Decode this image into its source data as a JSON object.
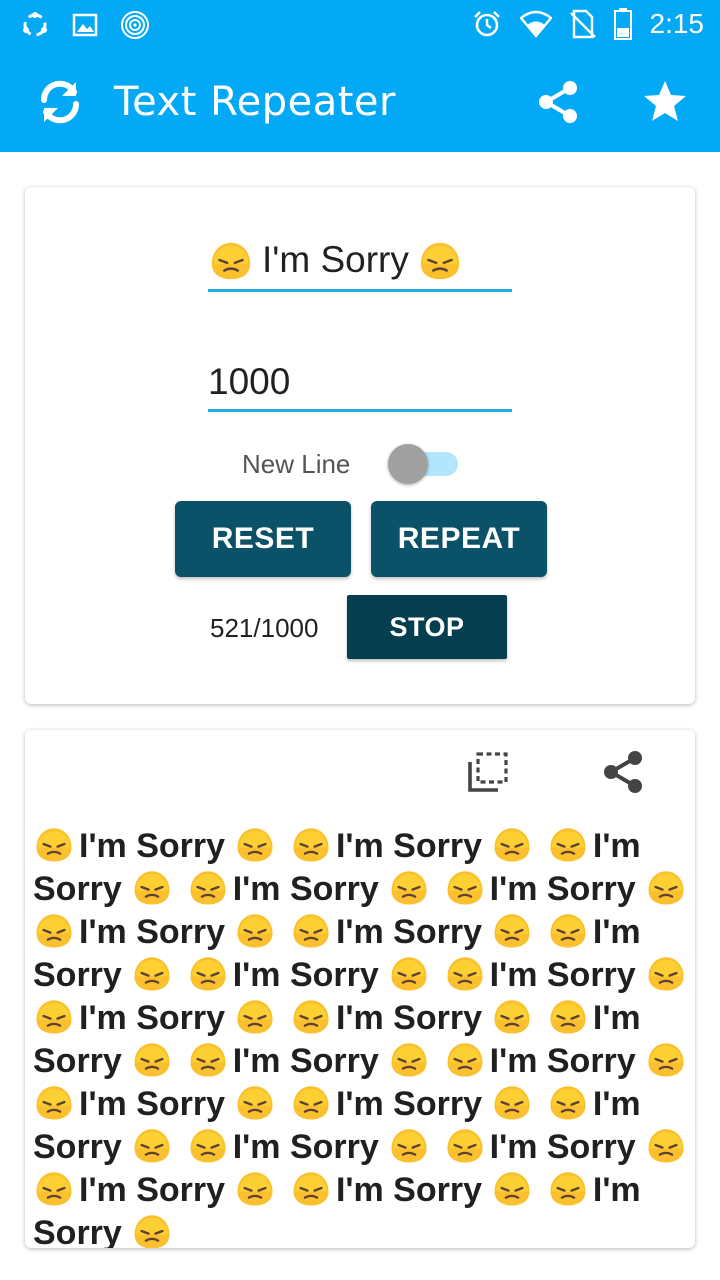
{
  "status_bar": {
    "time": "2:15",
    "left_icons": [
      "sync-circle-icon",
      "image-icon",
      "target-icon"
    ],
    "right_icons": [
      "alarm-icon",
      "wifi-icon",
      "no-sim-icon",
      "battery-icon"
    ]
  },
  "app_bar": {
    "title": "Text Repeater",
    "icons": [
      "repeat-icon",
      "share-icon",
      "star-icon"
    ]
  },
  "form": {
    "text_value": "I'm Sorry",
    "count_value": "1000",
    "newline_label": "New Line",
    "newline_enabled": false,
    "reset_label": "RESET",
    "repeat_label": "REPEAT",
    "progress": "521/1000",
    "stop_label": "STOP"
  },
  "output": {
    "icons": [
      "copy-icon",
      "share-icon"
    ],
    "repeat_text": "I'm Sorry",
    "repeat_count_visible": 23
  },
  "colors": {
    "primary": "#03a9f4",
    "button": "#0b5168",
    "stop_button": "#053f4f",
    "underline": "#29a8e0",
    "emoji": "#fbc02d"
  }
}
